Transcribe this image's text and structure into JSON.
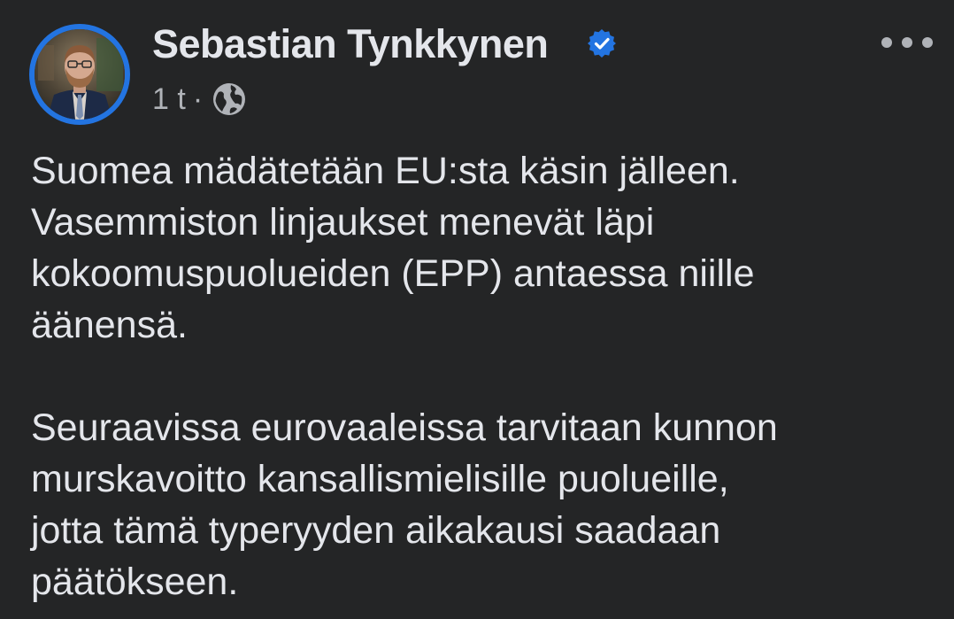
{
  "post": {
    "author": {
      "name": "Sebastian Tynkkynen",
      "verified": true,
      "avatar_icon": "profile-photo",
      "verified_icon": "verified-badge-icon"
    },
    "meta": {
      "time": "1 t",
      "separator": "·",
      "audience_icon": "globe-icon"
    },
    "more_icon": "more-options-icon",
    "paragraphs": [
      [
        "Suomea mädätetään EU:sta käsin jälleen.",
        "Vasemmiston linjaukset menevät läpi",
        "kokoomuspuolueiden (EPP) antaessa niille",
        "äänensä."
      ],
      [
        "Seuraavissa eurovaaleissa tarvitaan kunnon",
        "murskavoitto kansallismielisille puolueille,",
        "jotta tämä typeryyden aikakausi saadaan",
        "päätökseen."
      ]
    ]
  },
  "colors": {
    "background": "#242526",
    "primary_text": "#e4e6eb",
    "secondary_text": "#b0b3b8",
    "accent_blue": "#2374e1"
  }
}
